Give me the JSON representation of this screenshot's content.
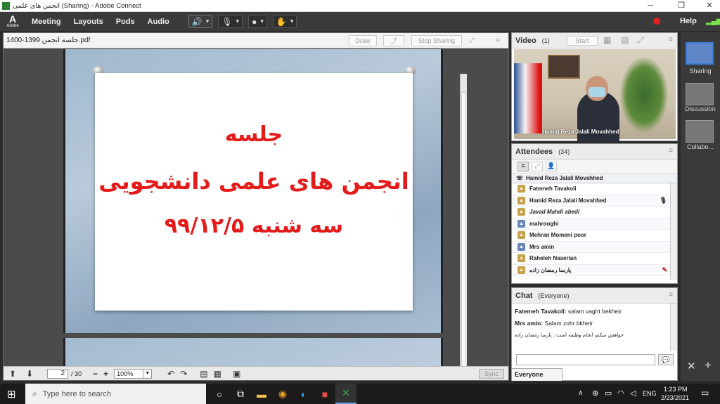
{
  "window": {
    "title": "انجمن های علمی (Sharing) - Adobe Connect",
    "minimize": "─",
    "restore": "❐",
    "close": "✕"
  },
  "menubar": {
    "logo_text": "Adobe",
    "items": [
      "Meeting",
      "Layouts",
      "Pods",
      "Audio"
    ],
    "help": "Help",
    "speaker_icon": "speaker-icon",
    "mic_icon": "microphone-icon",
    "camera_icon": "webcam-icon",
    "raise_hand_icon": "raise-hand-icon"
  },
  "share_pod": {
    "file_name": "جلسه انجمن 1399-1400.pdf",
    "draw_label": "Draw",
    "stop_sharing_label": "Stop Sharing",
    "slide": {
      "line1": "جلسه",
      "line2": "انجمن های علمی دانشجویی",
      "line3": "سه شنبه ۹۹/۱۲/۵"
    },
    "footer": {
      "page_current": "2",
      "page_total": "/ 30",
      "zoom": "100%",
      "sync_label": "Sync"
    }
  },
  "video": {
    "title": "Video",
    "count": "(1)",
    "start_label": "Start",
    "presenter_name": "Hamid Reza Jalali Movahhed"
  },
  "attendees": {
    "title": "Attendees",
    "count": "(34)",
    "host": "Hamid Reza Jalali Movahhed",
    "list": [
      {
        "name": "Fatemeh Tavakoli",
        "italic": false
      },
      {
        "name": "Hamid Reza Jalali Movahhed",
        "italic": false
      },
      {
        "name": "Javad Mahdi abedi",
        "italic": true
      },
      {
        "name": "mahrooghi",
        "italic": false
      },
      {
        "name": "Mehran Momeni poor",
        "italic": false
      },
      {
        "name": "Mrs amin",
        "italic": false
      },
      {
        "name": "Raheleh Naserian",
        "italic": false
      },
      {
        "name": "پارسا رمضان زاده",
        "italic": false
      }
    ]
  },
  "chat": {
    "title": "Chat",
    "scope": "(Everyone)",
    "messages": [
      {
        "sender": "Fatemeh Tavakoli:",
        "text": "salam vaght bekheir"
      },
      {
        "sender": "Mrs amin:",
        "text": "Salam zohr bkheir"
      },
      {
        "sender": "",
        "text": "خواهش میکنم انجام وظیفه است : پارسا رمضان زاده"
      }
    ],
    "tab_label": "Everyone"
  },
  "layouts": [
    "Sharing",
    "Discussion",
    "Collabo..."
  ],
  "taskbar": {
    "search_placeholder": "Type here to search",
    "time": "1:23 PM",
    "date": "2/23/2021",
    "lang": "ENG"
  },
  "colors": {
    "slide_text": "#e41b1b",
    "active_layout": "#3b7bd4",
    "audio_on": "#7ee04a"
  }
}
